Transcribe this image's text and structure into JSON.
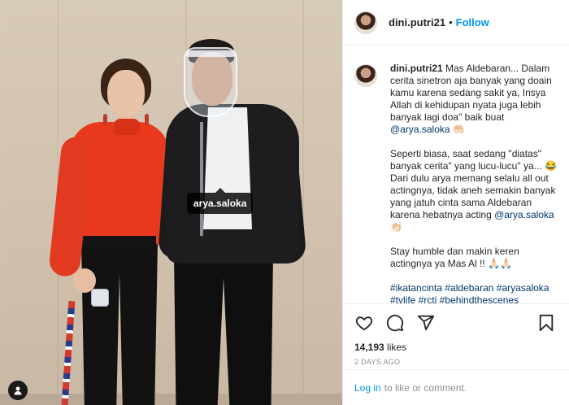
{
  "post": {
    "photo_tag": "arya.saloka"
  },
  "header": {
    "username": "dini.putri21",
    "separator": "•",
    "follow_label": "Follow"
  },
  "caption": {
    "username": "dini.putri21",
    "p1_text": " Mas Aldebaran... Dalam cerita sinetron aja banyak yang doain kamu karena sedang sakit ya, Insya Allah di kehidupan nyata juga lebih banyak lagi doa\" baik buat ",
    "p1_mention": "@arya.saloka",
    "p1_end": " 🤲🏻",
    "p2_text": "Seperti biasa, saat sedang \"diatas\" banyak cerita\" yang lucu-lucu\" ya... 😂 Dari dulu arya memang selalu all out actingnya, tidak aneh semakin banyak yang jatuh cinta sama Aldebaran karena hebatnya acting ",
    "p2_mention": "@arya.saloka",
    "p2_end": " 👏🏻",
    "p3_text": "Stay humble dan makin keren actingnya ya Mas Al !! 🙏🏻🙏🏻",
    "hashtags": "#ikatancinta #aldebaran #aryasaloka #tvlife #rcti #behindthescenes"
  },
  "actions": {
    "likes_count": "14,193",
    "likes_label": " likes",
    "timestamp": "2 DAYS AGO"
  },
  "login": {
    "link_label": "Log in",
    "rest_text": "to like or comment."
  },
  "icons": [
    "heart-icon",
    "comment-icon",
    "share-icon",
    "bookmark-icon",
    "user-tag-icon"
  ],
  "colors": {
    "accent": "#0095f6",
    "mention": "#00376b",
    "muted": "#8e8e8e"
  }
}
